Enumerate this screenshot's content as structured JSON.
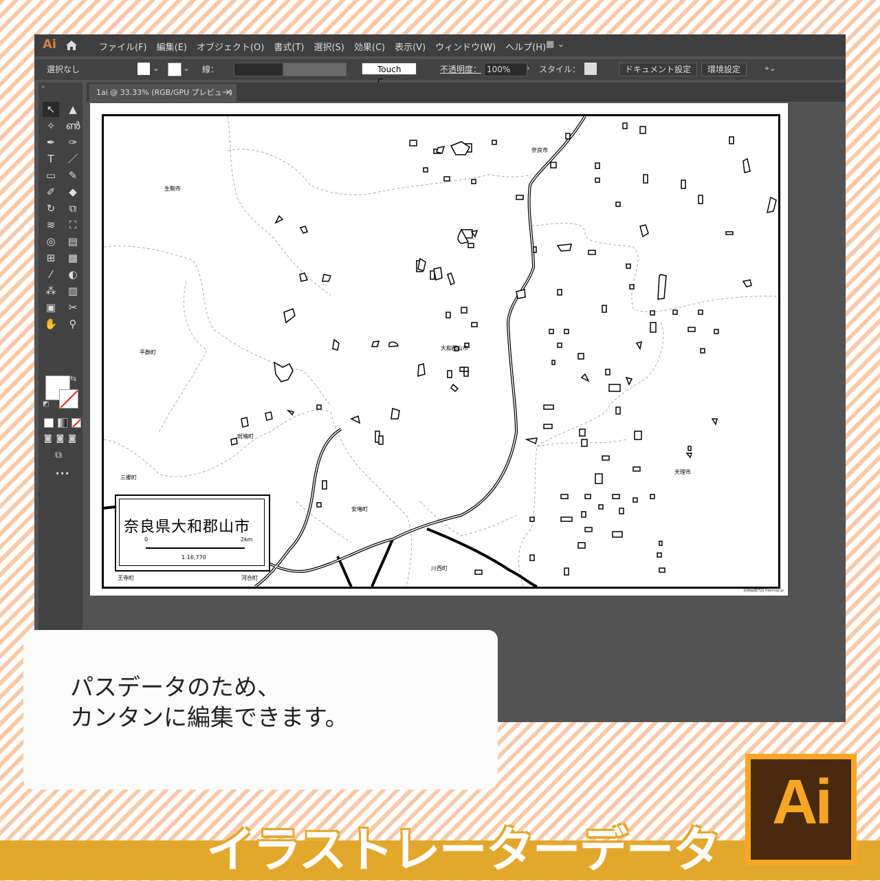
{
  "app": {
    "logo": "Ai",
    "menu": [
      "ファイル(F)",
      "編集(E)",
      "オブジェクト(O)",
      "書式(T)",
      "選択(S)",
      "効果(C)",
      "表示(V)",
      "ウィンドウ(W)",
      "ヘルプ(H)"
    ],
    "workspace": "▦ ⌄"
  },
  "control_bar": {
    "selection": "選択なし",
    "stroke_label": "線：",
    "brush": "Touch C...",
    "opacity_label": "不透明度：",
    "opacity_value": "100%",
    "style_label": "スタイル：",
    "doc_settings": "ドキュメント設定",
    "preferences": "環境設定"
  },
  "document_tab": {
    "title": "1ai @ 33.33% (RGB/GPU プレビュー)",
    "close": "×"
  },
  "map": {
    "places": [
      "奈良市",
      "生駒市",
      "平群町",
      "大和郡山市",
      "斑鳩町",
      "三郷町",
      "安堵町",
      "天理市",
      "川西町",
      "王寺町",
      "河合町"
    ],
    "legend_title": "奈良県大和郡山市",
    "scale_start": "0",
    "scale_end": "2km",
    "scale_ratio": "1:16,770",
    "credit": "白地図専門店 freemap.jp"
  },
  "caption": {
    "line1": "パスデータのため、",
    "line2": "カンタンに編集できます。"
  },
  "banner": {
    "title": "イラストレーターデータ",
    "logo_text": "Ai"
  },
  "colors": {
    "accent": "#e2a82d",
    "stripe": "#f7c9a9",
    "ui_dark": "#535353",
    "ai_orange": "#f7a623",
    "ai_brown": "#4a2a0f"
  }
}
